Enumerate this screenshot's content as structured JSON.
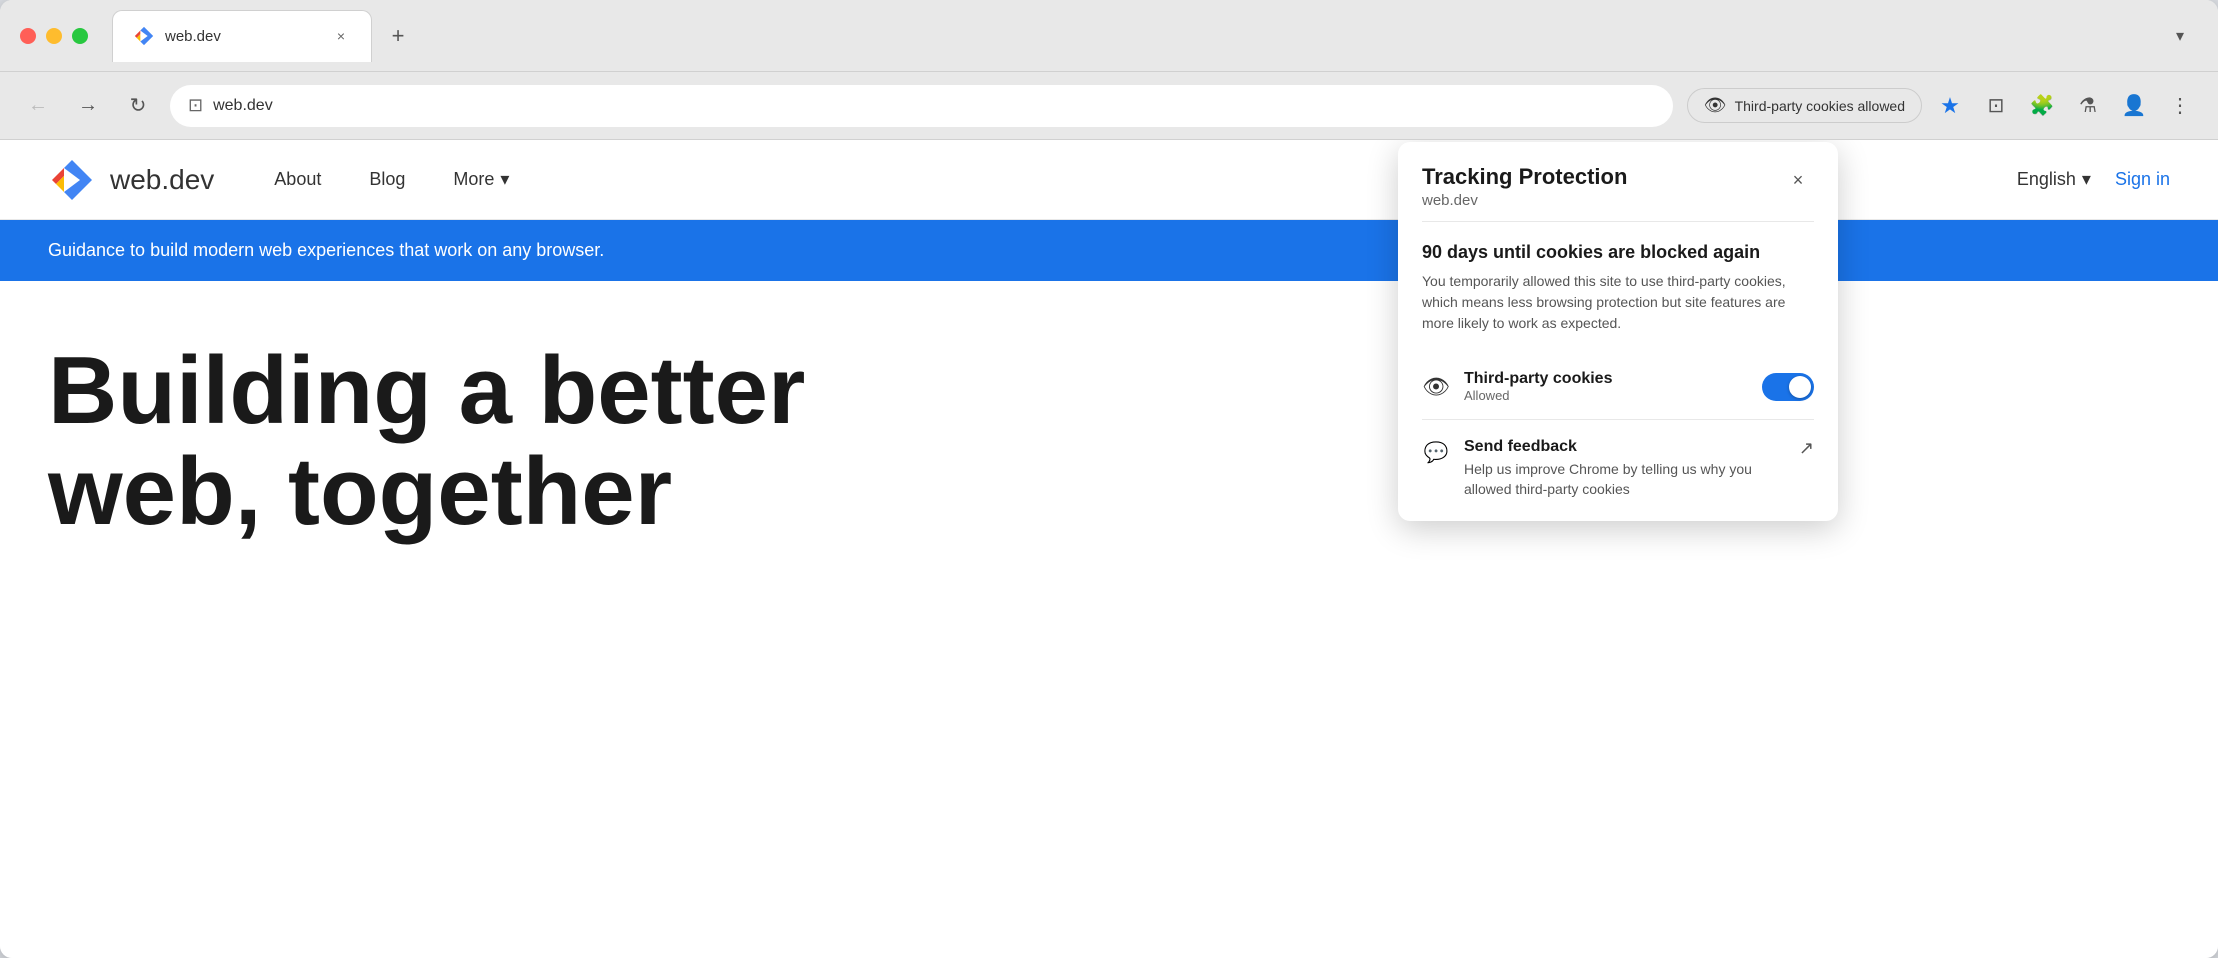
{
  "browser": {
    "tab": {
      "favicon_label": "web.dev favicon",
      "title": "web.dev",
      "close_label": "×",
      "new_tab_label": "+"
    },
    "tab_list_label": "▾",
    "address": {
      "url": "web.dev",
      "icon_label": "🔒"
    },
    "cookie_badge": {
      "icon": "👁",
      "label": "Third-party cookies allowed"
    },
    "star_label": "★",
    "nav": {
      "back_label": "←",
      "forward_label": "→",
      "reload_label": "↻"
    },
    "toolbar_icons": {
      "screenshot": "⊡",
      "extensions": "🧩",
      "lab": "⚗",
      "profile": "👤",
      "menu": "⋮"
    }
  },
  "site": {
    "logo_text": "web.dev",
    "nav": {
      "about": "About",
      "blog": "Blog",
      "more": "More",
      "more_arrow": "▾"
    },
    "language": {
      "label": "English",
      "arrow": "▾"
    },
    "sign_in": "Sign in",
    "banner_text": "Guidance to build modern web experiences that work on any browser.",
    "hero_title_line1": "Building a better",
    "hero_title_line2": "web, together"
  },
  "popup": {
    "title": "Tracking Protection",
    "subtitle": "web.dev",
    "close_label": "×",
    "warning_title": "90 days until cookies are blocked again",
    "warning_text": "You temporarily allowed this site to use third-party cookies, which means less browsing protection but site features are more likely to work as expected.",
    "cookie_row": {
      "icon": "👁",
      "label": "Third-party cookies",
      "status": "Allowed",
      "toggle_state": true
    },
    "feedback": {
      "icon": "💬",
      "label": "Send feedback",
      "text": "Help us improve Chrome by telling us why you allowed third-party cookies",
      "ext_icon": "↗"
    }
  }
}
